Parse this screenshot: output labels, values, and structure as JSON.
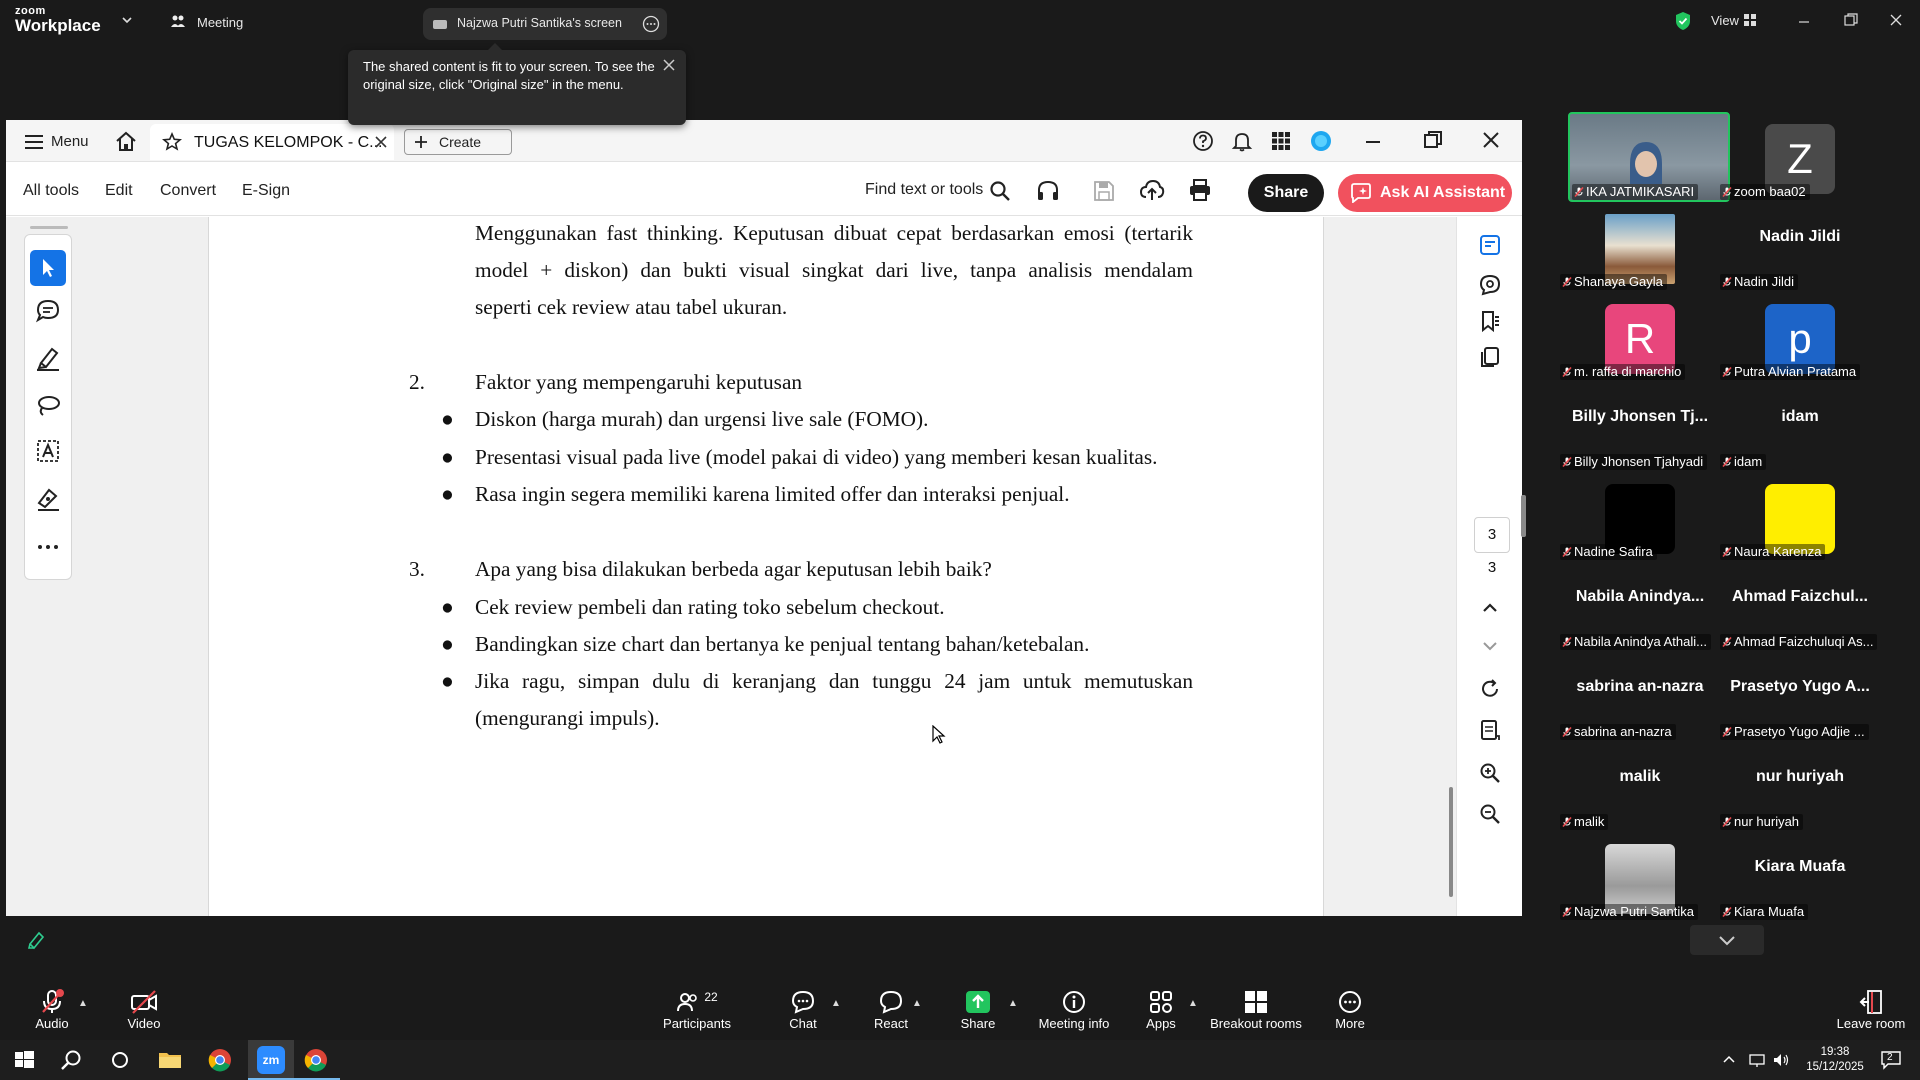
{
  "zoom": {
    "logo_small": "zoom",
    "logo_big": "Workplace",
    "meeting_label": "Meeting",
    "screen_tab_label": "Najzwa Putri Santika's screen",
    "view_label": "View",
    "tooltip_text": "The shared content is fit to your screen. To see the original size, click \"Original size\" in the menu."
  },
  "acrobat": {
    "menu_label": "Menu",
    "tab_title": "TUGAS KELOMPOK - C...",
    "create_label": "Create",
    "tools": [
      "All tools",
      "Edit",
      "Convert",
      "E-Sign"
    ],
    "find_label": "Find text or tools",
    "share_label": "Share",
    "ai_label": "Ask AI Assistant",
    "page_current": "3",
    "page_total": "3"
  },
  "document": {
    "para_top": [
      "Menggunakan fast thinking. Keputusan dibuat cepat berdasarkan emosi (tertarik",
      "model + diskon) dan bukti visual singkat dari live, tanpa analisis mendalam",
      "seperti cek review atau tabel ukuran."
    ],
    "section2_num": "2.",
    "section2_title": "Faktor yang mempengaruhi keputusan",
    "section2_bullets": [
      "Diskon (harga murah) dan urgensi live sale (FOMO).",
      "Presentasi visual pada live (model pakai di video) yang memberi kesan kualitas.",
      "Rasa ingin segera memiliki karena limited offer dan interaksi penjual."
    ],
    "section3_num": "3.",
    "section3_title": "Apa yang bisa dilakukan berbeda agar keputusan lebih baik?",
    "section3_bullets": [
      "Cek review pembeli dan rating toko sebelum checkout.",
      "Bandingkan size chart dan bertanya ke penjual tentang bahan/ketebalan.",
      "Jika ragu, simpan dulu di keranjang dan tunggu 24 jam untuk memutuskan"
    ],
    "section3_last_cont": "(mengurangi impuls)."
  },
  "participants": [
    {
      "label": "IKA JATMIKASARI",
      "kind": "video"
    },
    {
      "label": "zoom baa02",
      "kind": "avatar",
      "letter": "Z",
      "color": "#4a4a4a"
    },
    {
      "label": "Shanaya Gayla",
      "kind": "photo"
    },
    {
      "label": "Nadin Jildi",
      "kind": "name",
      "big": "Nadin Jildi"
    },
    {
      "label": "m. raffa di marchio",
      "kind": "avatar",
      "letter": "R",
      "color": "#e8467c"
    },
    {
      "label": "Putra Alvian Pratama",
      "kind": "avatar",
      "letter": "p",
      "color": "#1d64c8"
    },
    {
      "label": "Billy Jhonsen Tjahyadi",
      "kind": "name",
      "big": "Billy Jhonsen Tj..."
    },
    {
      "label": "idam",
      "kind": "name",
      "big": "idam"
    },
    {
      "label": "Nadine Safira",
      "kind": "avatar",
      "letter": "",
      "color": "#000000"
    },
    {
      "label": "Naura Karenza",
      "kind": "avatar",
      "letter": "",
      "color": "#ffee00"
    },
    {
      "label": "Nabila Anindya Athali...",
      "kind": "name",
      "big": "Nabila  Anindya..."
    },
    {
      "label": "Ahmad Faizchuluqi As...",
      "kind": "name",
      "big": "Ahmad  Faizchul..."
    },
    {
      "label": "sabrina an-nazra",
      "kind": "name",
      "big": "sabrina an-nazra"
    },
    {
      "label": "Prasetyo Yugo Adjie ...",
      "kind": "name",
      "big": "Prasetyo Yugo A..."
    },
    {
      "label": "malik",
      "kind": "name",
      "big": "malik"
    },
    {
      "label": "nur huriyah",
      "kind": "name",
      "big": "nur huriyah"
    },
    {
      "label": "Najzwa Putri Santika",
      "kind": "photo2"
    },
    {
      "label": "Kiara Muafa",
      "kind": "name",
      "big": "Kiara Muafa"
    }
  ],
  "toolbar": {
    "audio": "Audio",
    "video": "Video",
    "participants": "Participants",
    "participants_count": "22",
    "chat": "Chat",
    "react": "React",
    "share": "Share",
    "meeting_info": "Meeting info",
    "apps": "Apps",
    "breakout": "Breakout rooms",
    "more": "More",
    "leave": "Leave room"
  },
  "taskbar": {
    "time": "19:38",
    "date": "15/12/2025",
    "notif_count": "2"
  },
  "colors": {
    "acrobat_blue": "#1473e6",
    "ai_button": "#f1515e",
    "share_green": "#22c55e",
    "muted_red": "#e5484d"
  }
}
